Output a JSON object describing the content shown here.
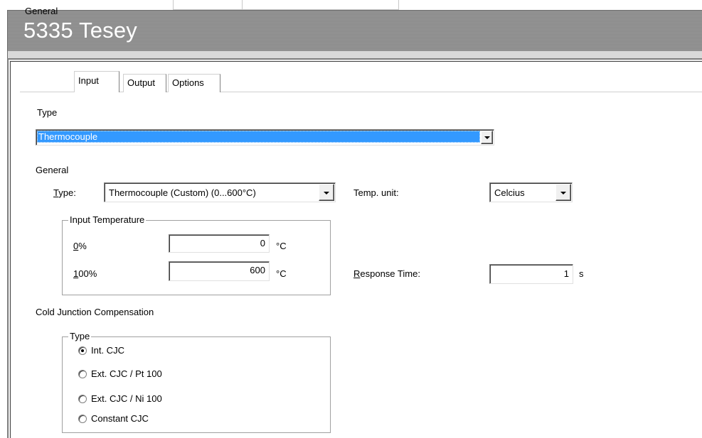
{
  "window": {
    "title": "5335 Tesey"
  },
  "tabs": [
    {
      "label": "General"
    },
    {
      "label": "Input",
      "active": true
    },
    {
      "label": "Output"
    },
    {
      "label": "Options"
    }
  ],
  "input_type": {
    "label": "Type",
    "value": "Thermocouple"
  },
  "general": {
    "section_label": "General",
    "type_label_prefix": "T",
    "type_label_rest": "ype:",
    "type_value": "Thermocouple (Custom) (0...600°C)",
    "temp_unit_label": "Temp. unit:",
    "temp_unit_value": "Celcius",
    "input_temperature": {
      "legend": "Input Temperature",
      "low_label_prefix": "0",
      "low_label_rest": "%",
      "low_value": "0",
      "low_unit": "°C",
      "high_label_prefix": "1",
      "high_label_rest": "00%",
      "high_value": "600",
      "high_unit": "°C"
    },
    "response_time_label_prefix": "R",
    "response_time_label_rest": "esponse Time:",
    "response_time_value": "1",
    "response_time_unit": "s"
  },
  "cjc": {
    "section_label": "Cold Junction Compensation",
    "legend": "Type",
    "options": [
      {
        "label": "Int. CJC",
        "checked": true
      },
      {
        "label": "Ext. CJC / Pt 100",
        "checked": false
      },
      {
        "label": "Ext. CJC / Ni 100",
        "checked": false
      },
      {
        "label": "Constant CJC",
        "checked": false
      }
    ]
  },
  "colors": {
    "selection": "#3399ff",
    "header_bg": "#8f8f8f",
    "panel_bg": "#ffffff"
  }
}
